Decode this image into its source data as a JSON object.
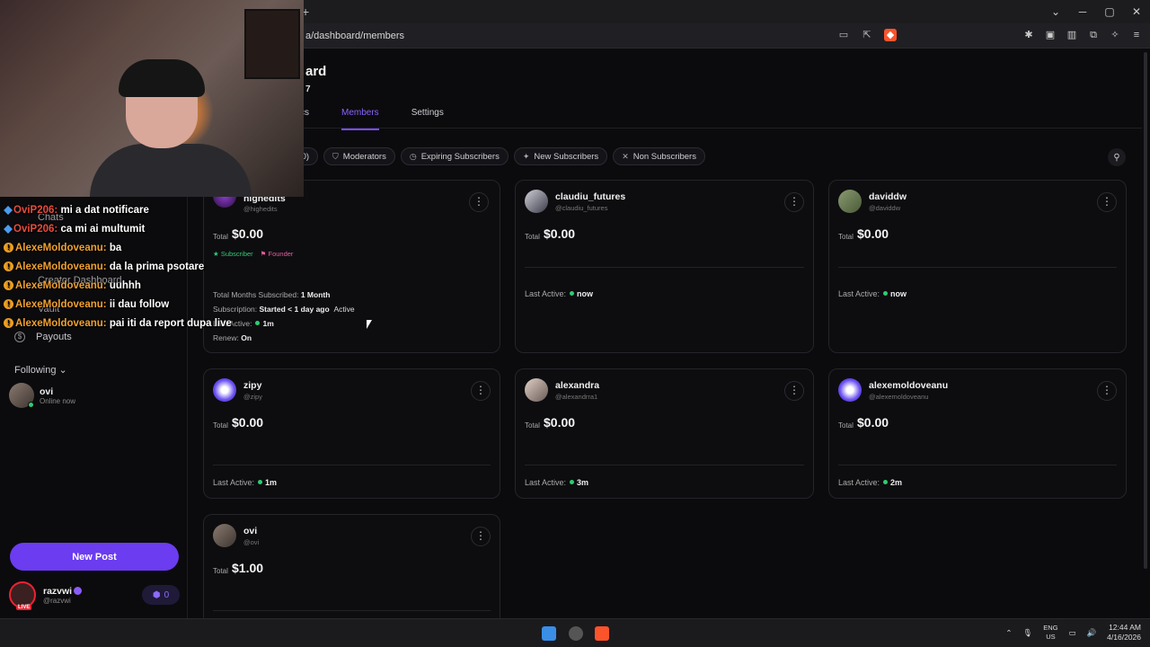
{
  "browser": {
    "url": "a/dashboard/members",
    "new_tab": "+",
    "win_min": "─",
    "win_max": "▢",
    "win_close": "✕",
    "win_down": "⌄"
  },
  "page": {
    "title": "ard",
    "subtitle": "7"
  },
  "tabs": [
    {
      "label": "cs"
    },
    {
      "label": "Members"
    },
    {
      "label": "Settings"
    }
  ],
  "filters": {
    "all_count": "100)",
    "moderators": "Moderators",
    "expiring": "Expiring Subscribers",
    "new_subs": "New Subscribers",
    "non_subs": "Non Subscribers"
  },
  "chat": [
    {
      "user": "OviP206:",
      "msg": "mi a dat notificare",
      "color": "red"
    },
    {
      "user": "OviP206:",
      "msg": "ca mi ai multumit",
      "color": "red"
    },
    {
      "user": "AlexeMoldoveanu:",
      "msg": "ba",
      "color": "orange"
    },
    {
      "user": "AlexeMoldoveanu:",
      "msg": "da la prima psotare",
      "color": "orange"
    },
    {
      "user": "AlexeMoldoveanu:",
      "msg": "uuhhh",
      "color": "orange"
    },
    {
      "user": "AlexeMoldoveanu:",
      "msg": "ii dau follow",
      "color": "orange"
    },
    {
      "user": "AlexeMoldoveanu:",
      "msg": "pai iti da report dupa live",
      "color": "orange"
    }
  ],
  "sidebar": {
    "chats": "Chats",
    "creator_dashboard": "Creator Dashboard",
    "vault": "Vault",
    "payouts": "Payouts",
    "following": "Following",
    "follow_user": {
      "name": "ovi",
      "status": "Online now"
    },
    "new_post": "New Post",
    "profile": {
      "name": "razvwi",
      "handle": "@razvwi",
      "coins": "0",
      "live": "LIVE"
    }
  },
  "members": [
    {
      "name": "highedits",
      "handle": "@highedits",
      "total_label": "Total",
      "total": "$0.00",
      "badge_sub": "Subscriber",
      "badge_founder": "Founder",
      "months_label": "Total Months Subscribed:",
      "months": "1 Month",
      "sub_label": "Subscription:",
      "sub_started": "Started < 1 day ago",
      "sub_status": "Active",
      "last_active_label": "Last Active:",
      "last_active": "1m",
      "renew_label": "Renew:",
      "renew": "On"
    },
    {
      "name": "claudiu_futures",
      "handle": "@claudiu_futures",
      "total_label": "Total",
      "total": "$0.00",
      "last_active_label": "Last Active:",
      "last_active": "now"
    },
    {
      "name": "daviddw",
      "handle": "@daviddw",
      "total_label": "Total",
      "total": "$0.00",
      "last_active_label": "Last Active:",
      "last_active": "now"
    },
    {
      "name": "zipy",
      "handle": "@zipy",
      "total_label": "Total",
      "total": "$0.00",
      "last_active_label": "Last Active:",
      "last_active": "1m"
    },
    {
      "name": "alexandra",
      "handle": "@alexandrra1",
      "total_label": "Total",
      "total": "$0.00",
      "last_active_label": "Last Active:",
      "last_active": "3m"
    },
    {
      "name": "alexemoldoveanu",
      "handle": "@alexemoldoveanu",
      "total_label": "Total",
      "total": "$0.00",
      "last_active_label": "Last Active:",
      "last_active": "2m"
    },
    {
      "name": "ovi",
      "handle": "@ovi",
      "total_label": "Total",
      "total": "$1.00"
    }
  ],
  "taskbar": {
    "lang_top": "ENG",
    "lang_bottom": "US",
    "time": "12:44 AM",
    "date": "4/16/2026"
  },
  "colors": {
    "accent": "#7b4dff",
    "online": "#2ecc71",
    "new_post": "#6b3cf0"
  }
}
